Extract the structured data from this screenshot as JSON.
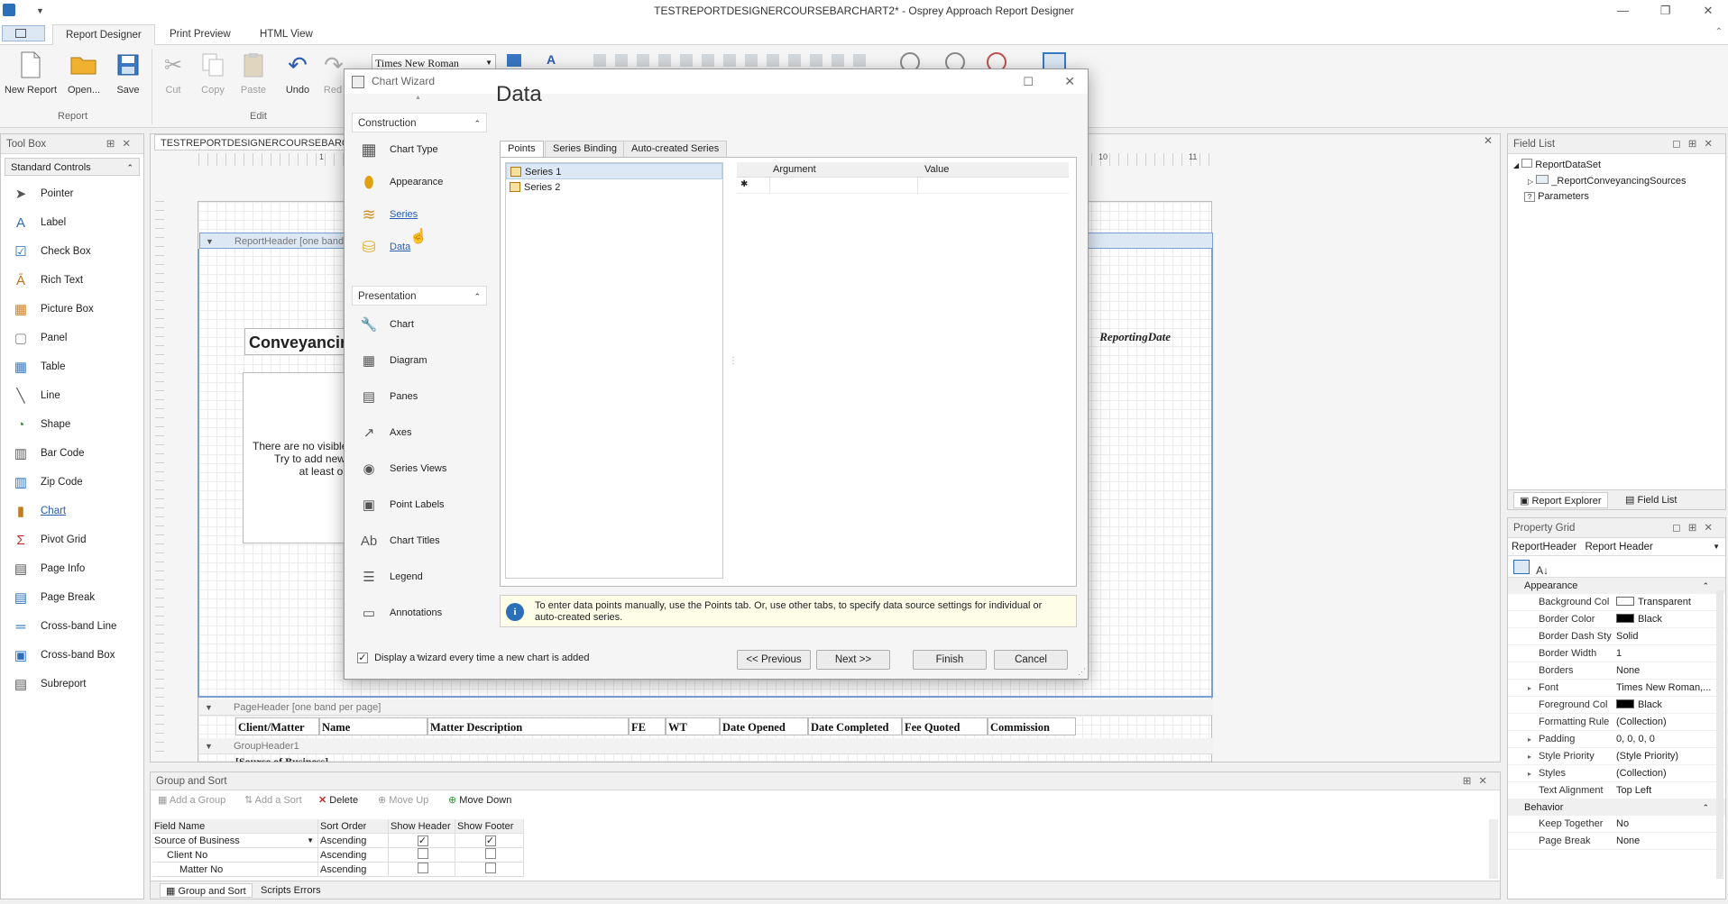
{
  "window": {
    "title": "TESTREPORTDESIGNERCOURSEBARCHART2* - Osprey Approach Report Designer"
  },
  "ribbon": {
    "tabs": [
      "Report Designer",
      "Print Preview",
      "HTML View"
    ],
    "report_group": {
      "label": "Report",
      "buttons": [
        "New Report",
        "Open...",
        "Save"
      ]
    },
    "edit_group": {
      "label": "Edit",
      "buttons": [
        "Cut",
        "Copy",
        "Paste",
        "Undo",
        "Red"
      ]
    },
    "font_name": "Times New Roman"
  },
  "toolbox": {
    "title": "Tool Box",
    "category": "Standard Controls",
    "items": [
      "Pointer",
      "Label",
      "Check Box",
      "Rich Text",
      "Picture Box",
      "Panel",
      "Table",
      "Line",
      "Shape",
      "Bar Code",
      "Zip Code",
      "Chart",
      "Pivot Grid",
      "Page Info",
      "Page Break",
      "Cross-band Line",
      "Cross-band Box",
      "Subreport"
    ]
  },
  "designer": {
    "tab_label": "TESTREPORTDESIGNERCOURSEBARCHART",
    "report_header_band": "ReportHeader [one band",
    "title_text": "Conveyancin",
    "reporting_date": "ReportingDate",
    "placeholder_lines": [
      "There are no visible",
      "Try to add new",
      "at least o"
    ],
    "page_header_band": "PageHeader [one band per page]",
    "group_header_band": "GroupHeader1",
    "group_field_partial": "[Source of Business]",
    "ruler_ticks": [
      "1",
      "10",
      "11"
    ],
    "columns": [
      "Client/Matter",
      "Name",
      "Matter Description",
      "FE",
      "WT",
      "Date Opened",
      "Date Completed",
      "Fee Quoted",
      "Commission"
    ]
  },
  "wizard": {
    "title": "Chart Wizard",
    "heading": "Data",
    "construction_label": "Construction",
    "construction_items": [
      "Chart Type",
      "Appearance",
      "Series",
      "Data"
    ],
    "presentation_label": "Presentation",
    "presentation_items": [
      "Chart",
      "Diagram",
      "Panes",
      "Axes",
      "Series Views",
      "Point Labels",
      "Chart Titles",
      "Legend",
      "Annotations"
    ],
    "tabs": [
      "Points",
      "Series Binding",
      "Auto-created Series"
    ],
    "series": [
      "Series 1",
      "Series 2"
    ],
    "grid_columns": [
      "Argument",
      "Value"
    ],
    "new_row_marker": "✱",
    "info_text": "To enter data points manually, use the Points tab. Or, use other tabs, to specify data source settings for individual or auto-created series.",
    "checkbox_label": "Display a wizard every time a new chart is added",
    "checkbox_checked": true,
    "buttons": {
      "previous": "<< Previous",
      "next": "Next >>",
      "finish": "Finish",
      "cancel": "Cancel"
    }
  },
  "field_list": {
    "title": "Field List",
    "nodes": [
      "ReportDataSet",
      "_ReportConveyancingSources",
      "Parameters"
    ],
    "bottom_tabs": [
      "Report Explorer",
      "Field List"
    ]
  },
  "property_grid": {
    "title": "Property Grid",
    "selected": "ReportHeader",
    "selected_type": "Report Header",
    "appearance_label": "Appearance",
    "rows": [
      {
        "k": "Background Col",
        "v": "Transparent",
        "swatch": "#ffffff"
      },
      {
        "k": "Border Color",
        "v": "Black",
        "swatch": "#000000"
      },
      {
        "k": "Border Dash Sty",
        "v": "Solid"
      },
      {
        "k": "Border Width",
        "v": "1"
      },
      {
        "k": "Borders",
        "v": "None"
      },
      {
        "k": "Font",
        "v": "Times New Roman,...",
        "expand": true
      },
      {
        "k": "Foreground Col",
        "v": "Black",
        "swatch": "#000000"
      },
      {
        "k": "Formatting Rule",
        "v": "(Collection)"
      },
      {
        "k": "Padding",
        "v": "0, 0, 0, 0",
        "expand": true
      },
      {
        "k": "Style Priority",
        "v": "(Style Priority)",
        "expand": true
      },
      {
        "k": "Styles",
        "v": "(Collection)",
        "expand": true
      },
      {
        "k": "Text Alignment",
        "v": "Top Left"
      }
    ],
    "behavior_label": "Behavior",
    "behavior_rows": [
      {
        "k": "Keep Together",
        "v": "No"
      },
      {
        "k": "Page Break",
        "v": "None"
      }
    ]
  },
  "group_sort": {
    "title": "Group and Sort",
    "toolbar": [
      "Add a Group",
      "Add a Sort",
      "Delete",
      "Move Up",
      "Move Down"
    ],
    "headers": [
      "Field Name",
      "Sort Order",
      "Show Header",
      "Show Footer"
    ],
    "rows": [
      {
        "field": "Source of Business",
        "order": "Ascending",
        "header": true,
        "footer": true
      },
      {
        "field": "Client No",
        "order": "Ascending",
        "header": false,
        "footer": false
      },
      {
        "field": "Matter No",
        "order": "Ascending",
        "header": false,
        "footer": false
      }
    ],
    "bottom_tabs": [
      "Group and Sort",
      "Scripts Errors"
    ]
  }
}
